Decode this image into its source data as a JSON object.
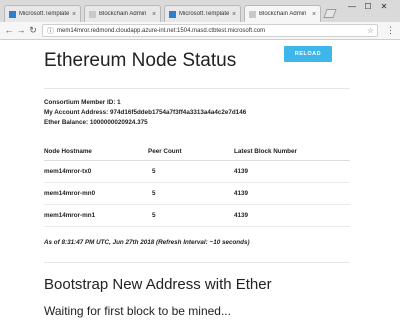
{
  "browser": {
    "tabs": [
      {
        "label": "Microsoft.Template - Mi"
      },
      {
        "label": "Blockchain Admin"
      },
      {
        "label": "Microsoft.Template - Mi"
      },
      {
        "label": "Blockchain Admin"
      }
    ],
    "url": "mem14mror.redmond.cloudapp.azure-int.net:1504.masd.ctbtest.microsoft.com",
    "colors": {
      "ms_icon": "#2f7fd0",
      "page_icon": "#c9c9c9"
    }
  },
  "page": {
    "title": "Ethereum Node Status",
    "reload_label": "RELOAD",
    "member_id": "Consortium Member ID: 1",
    "account_address": "My Account Address: 974d16f5ddeb1754a7f3ff4a3313a4a4c2e7d146",
    "ether_balance": "Ether Balance: 1000000020924.375",
    "table": {
      "headers": [
        "Node Hostname",
        "Peer Count",
        "Latest Block Number"
      ],
      "rows": [
        [
          "mem14mror-tx0",
          "5",
          "4139"
        ],
        [
          "mem14mror-mn0",
          "5",
          "4139"
        ],
        [
          "mem14mror-mn1",
          "5",
          "4139"
        ]
      ]
    },
    "status": "As of 8:31:47 PM UTC, Jun 27th 2018 (Refresh Interval: ~10 seconds)",
    "bootstrap_title": "Bootstrap New Address with Ether",
    "waiting_text": "Waiting for first block to be mined...",
    "accent_color": "#3fb6ea"
  }
}
